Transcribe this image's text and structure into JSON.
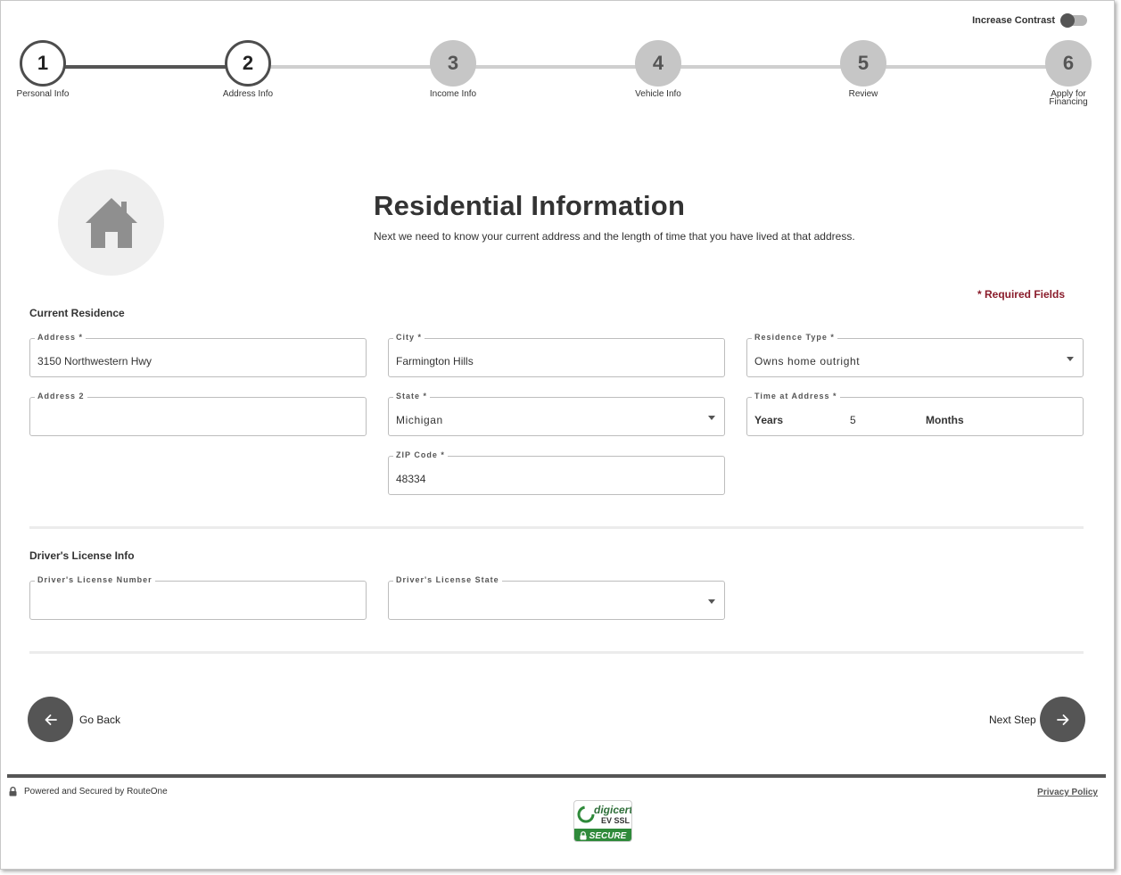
{
  "contrast_toggle": {
    "label": "Increase Contrast",
    "enabled": false
  },
  "steps": [
    {
      "number": "1",
      "label": "Personal Info",
      "state": "active"
    },
    {
      "number": "2",
      "label": "Address Info",
      "state": "active"
    },
    {
      "number": "3",
      "label": "Income Info",
      "state": "inactive"
    },
    {
      "number": "4",
      "label": "Vehicle Info",
      "state": "inactive"
    },
    {
      "number": "5",
      "label": "Review",
      "state": "inactive"
    },
    {
      "number": "6",
      "label": "Apply for Financing",
      "state": "inactive"
    }
  ],
  "header": {
    "icon": "house-icon",
    "title": "Residential Information",
    "subtitle": "Next we need to know your current address and the length of time that you have lived at that address."
  },
  "required_note": "* Required Fields",
  "residence": {
    "section_label": "Current Residence",
    "address": {
      "label": "Address *",
      "value": "3150 Northwestern Hwy"
    },
    "address2": {
      "label": "Address 2",
      "value": ""
    },
    "city": {
      "label": "City *",
      "value": "Farmington Hills"
    },
    "state": {
      "label": "State *",
      "value": "Michigan"
    },
    "zip": {
      "label": "ZIP Code *",
      "value": "48334"
    },
    "residence_type": {
      "label": "Residence Type *",
      "value": "Owns home outright"
    },
    "time_at_address": {
      "label": "Time at Address *",
      "years_label": "Years",
      "years_value": "5",
      "months_label": "Months",
      "months_value": ""
    }
  },
  "license": {
    "section_label": "Driver's License Info",
    "number": {
      "label": "Driver's License Number",
      "value": ""
    },
    "state": {
      "label": "Driver's License State",
      "value": ""
    }
  },
  "nav": {
    "back_label": "Go Back",
    "next_label": "Next Step"
  },
  "footer": {
    "powered": "Powered and Secured by RouteOne",
    "privacy": "Privacy Policy",
    "badge_brand": "digicert",
    "badge_ev": "EV SSL",
    "badge_secure": "SECURE"
  },
  "colors": {
    "primary_dark": "#555555",
    "required_red": "#8a1c2b",
    "inactive_step": "#c6c6c6",
    "secure_green": "#2f8a3a"
  }
}
